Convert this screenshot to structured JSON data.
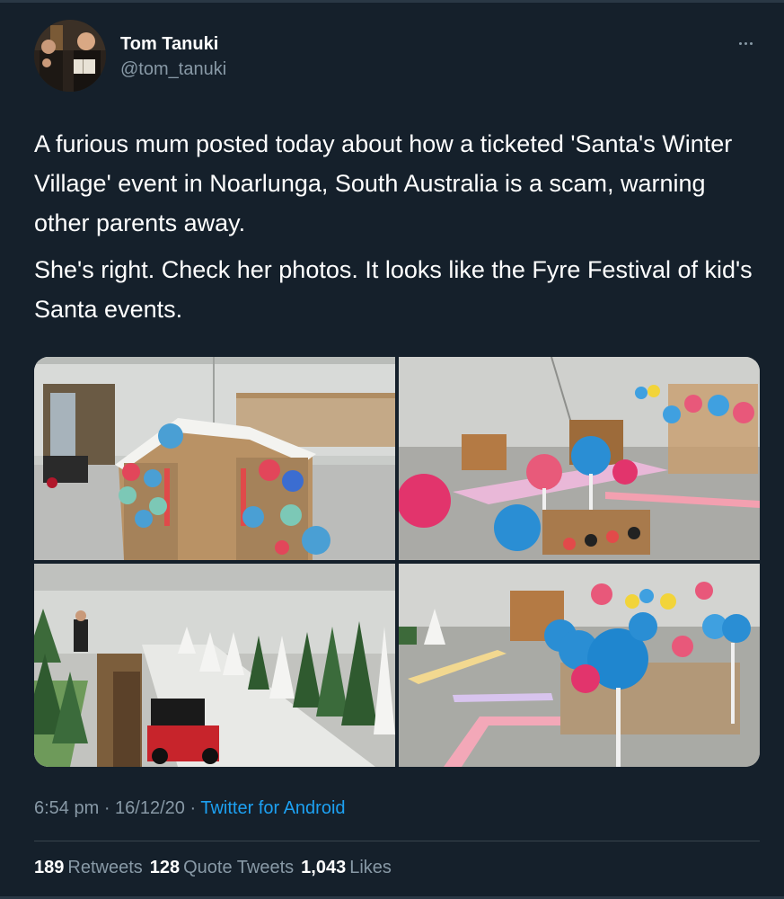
{
  "author": {
    "display_name": "Tom Tanuki",
    "handle": "@tom_tanuki"
  },
  "tweet": {
    "paragraphs": [
      "A furious mum posted today about how a ticketed 'Santa's Winter Village' event in Noarlunga, South Australia is a scam, warning other parents away.",
      "She's right. Check her photos. It looks like the Fyre Festival of kid's Santa events."
    ]
  },
  "meta": {
    "time": "6:54 pm",
    "separator": " · ",
    "date": "16/12/20",
    "source": "Twitter for Android"
  },
  "stats": {
    "retweets_count": "189",
    "retweets_label": "Retweets",
    "quote_count": "128",
    "quote_label": "Quote Tweets",
    "likes_count": "1,043",
    "likes_label": "Likes"
  },
  "colors": {
    "background": "#15202b",
    "secondary_text": "#8899a6",
    "link": "#1da1f2",
    "divider": "#38444d"
  },
  "icons": {
    "more": "more-horizontal-icon"
  }
}
